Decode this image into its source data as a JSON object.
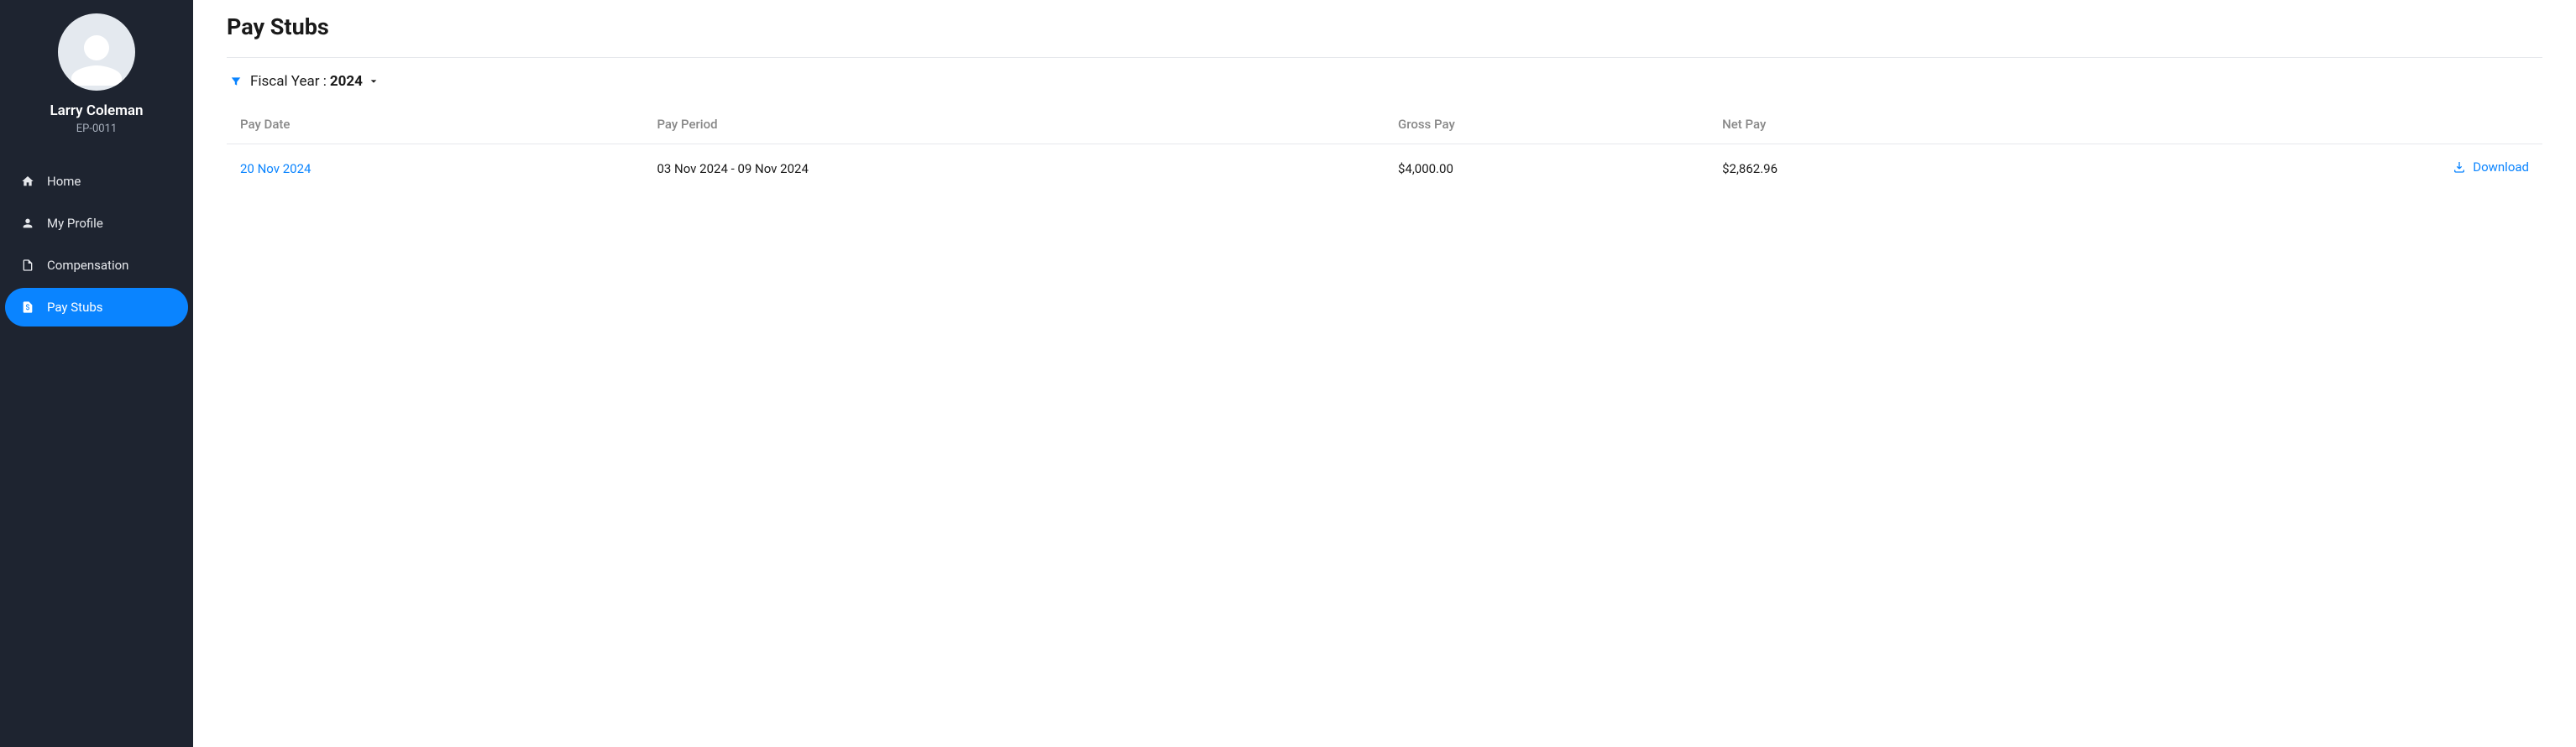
{
  "user": {
    "name": "Larry Coleman",
    "id": "EP-0011"
  },
  "nav": {
    "items": [
      {
        "label": "Home",
        "icon": "home-icon",
        "active": false
      },
      {
        "label": "My Profile",
        "icon": "person-icon",
        "active": false
      },
      {
        "label": "Compensation",
        "icon": "document-icon",
        "active": false
      },
      {
        "label": "Pay Stubs",
        "icon": "dollar-doc-icon",
        "active": true
      }
    ]
  },
  "page": {
    "title": "Pay Stubs"
  },
  "filter": {
    "label": "Fiscal Year :",
    "value": "2024"
  },
  "table": {
    "headers": {
      "payDate": "Pay Date",
      "payPeriod": "Pay Period",
      "grossPay": "Gross Pay",
      "netPay": "Net Pay"
    },
    "rows": [
      {
        "payDate": "20 Nov 2024",
        "payPeriod": "03 Nov 2024 - 09 Nov 2024",
        "grossPay": "$4,000.00",
        "netPay": "$2,862.96",
        "downloadLabel": "Download"
      }
    ]
  }
}
